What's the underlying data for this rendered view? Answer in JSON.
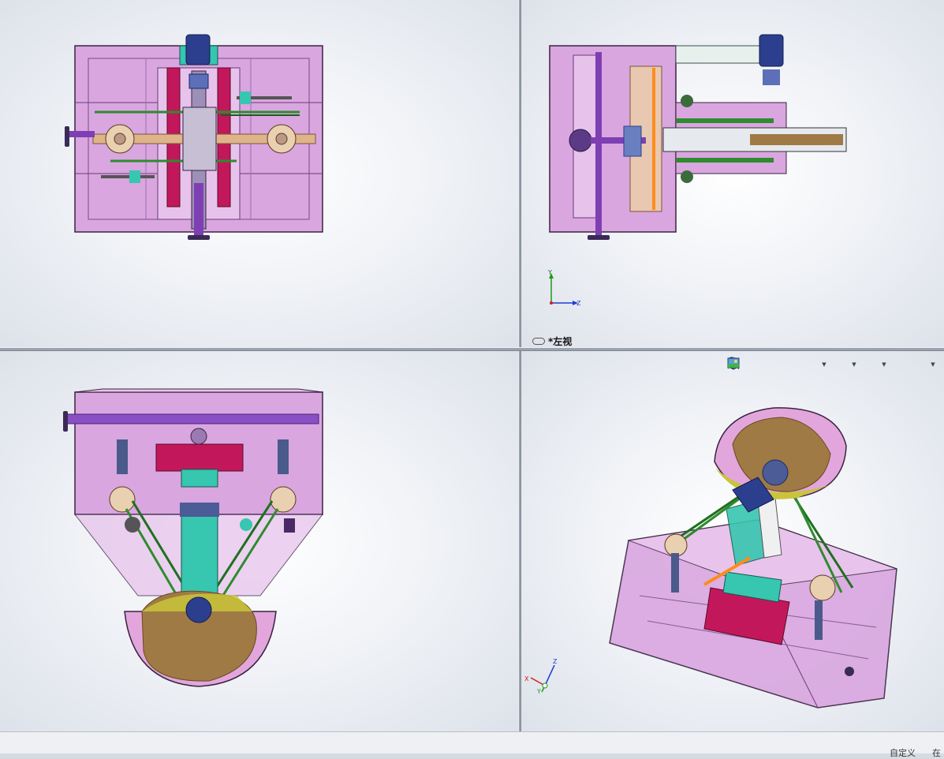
{
  "viewports": {
    "top_left_view": {
      "label": ""
    },
    "top_right_view": {
      "label": "*左视"
    },
    "bottom_left_view": {
      "label": ""
    },
    "bottom_right_view": {
      "label": ""
    }
  },
  "triads": {
    "left_view": {
      "y": "Y",
      "z": "Z"
    },
    "iso_view": {
      "x": "X",
      "y": "Y",
      "z": "Z"
    }
  },
  "toolbar": {
    "items": [
      {
        "icon": "zoom-to-fit-icon"
      },
      {
        "icon": "zoom-to-area-icon"
      },
      {
        "icon": "previous-view-icon"
      },
      {
        "icon": "section-view-icon"
      },
      {
        "icon": "view-orientation-icon",
        "has_dropdown": true
      },
      {
        "icon": "display-style-icon",
        "has_dropdown": true
      },
      {
        "icon": "hide-show-items-icon",
        "has_dropdown": true
      },
      {
        "icon": "edit-appearance-icon"
      },
      {
        "icon": "apply-scene-icon",
        "has_dropdown": true
      }
    ]
  },
  "statusbar": {
    "custom_label": "自定义",
    "trailing_text": "在"
  },
  "colors": {
    "housing": "#d9a6e0",
    "housing_stroke": "#3a2340",
    "motor": "#2c3f8f",
    "gear_frame": "#c2185b",
    "shaft": "#7e3fb3",
    "belt": "#2e8b2e",
    "blade": "#a07a45",
    "guard": "#c9c43a",
    "column": "#37c6b0",
    "accent_orange": "#ff8c1a"
  }
}
